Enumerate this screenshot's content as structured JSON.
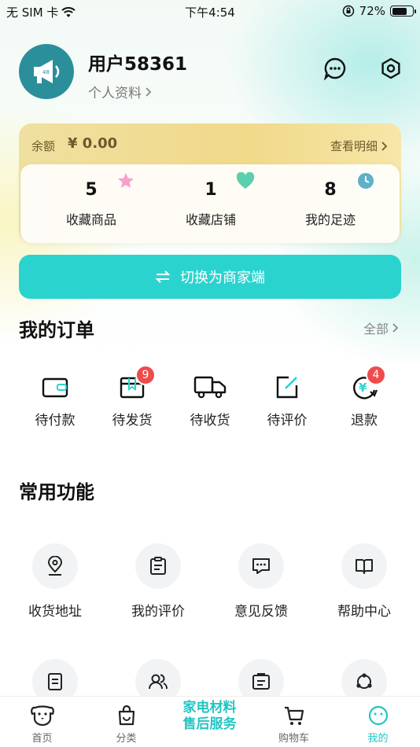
{
  "status": {
    "carrier": "无 SIM 卡",
    "time": "下午4:54",
    "battery": "72%",
    "battery_level": 0.72
  },
  "profile": {
    "username": "用户58361",
    "profile_link": "个人资料"
  },
  "balance": {
    "label": "余额",
    "value": "¥ 0.00",
    "detail_link": "查看明细"
  },
  "stats": [
    {
      "num": "5",
      "label": "收藏商品"
    },
    {
      "num": "1",
      "label": "收藏店铺"
    },
    {
      "num": "8",
      "label": "我的足迹"
    }
  ],
  "switch_button": "切换为商家端",
  "orders": {
    "title": "我的订单",
    "all_link": "全部",
    "items": [
      {
        "label": "待付款",
        "badge": ""
      },
      {
        "label": "待发货",
        "badge": "9"
      },
      {
        "label": "待收货",
        "badge": ""
      },
      {
        "label": "待评价",
        "badge": ""
      },
      {
        "label": "退款",
        "badge": "4"
      }
    ]
  },
  "functions": {
    "title": "常用功能",
    "items": [
      {
        "label": "收货地址",
        "icon": "location-icon"
      },
      {
        "label": "我的评价",
        "icon": "review-icon"
      },
      {
        "label": "意见反馈",
        "icon": "feedback-icon"
      },
      {
        "label": "帮助中心",
        "icon": "help-book-icon"
      }
    ],
    "row2_icons": [
      "document-icon",
      "users-icon",
      "clipboard-icon",
      "share-icon"
    ]
  },
  "tabbar": {
    "items": [
      {
        "label": "首页",
        "icon": "dog-icon"
      },
      {
        "label": "分类",
        "icon": "bag-icon"
      },
      {
        "label": "家电材料售后服务",
        "line1": "家电材料",
        "line2": "售后服务"
      },
      {
        "label": "购物车",
        "icon": "cart-icon"
      },
      {
        "label": "我的",
        "icon": "smile-icon"
      }
    ],
    "active": "我的"
  },
  "colors": {
    "accent": "#2bd3cf",
    "badge_red": "#ef4b4b",
    "balance_bg": "#f1d98a",
    "avatar_bg": "#2b8f9b"
  }
}
